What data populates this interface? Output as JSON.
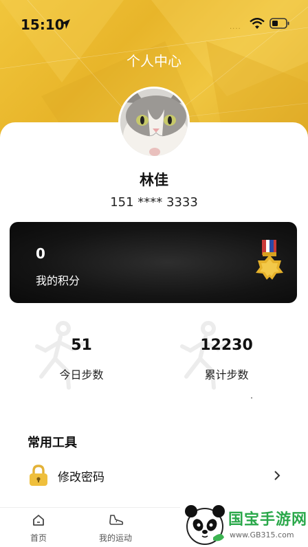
{
  "status_bar": {
    "time": "15:10",
    "signal_dots": "····"
  },
  "header": {
    "title": "个人中心"
  },
  "profile": {
    "name": "林佳",
    "phone": "151 **** 3333"
  },
  "points": {
    "value": "0",
    "label": "我的积分"
  },
  "steps": {
    "today": {
      "value": "51",
      "label": "今日步数"
    },
    "total": {
      "value": "12230",
      "label": "累计步数"
    }
  },
  "tools": {
    "title": "常用工具",
    "items": [
      {
        "label": "修改密码",
        "icon": "lock-icon"
      }
    ]
  },
  "tabbar": {
    "items": [
      {
        "label": "首页",
        "icon": "home-icon"
      },
      {
        "label": "我的运动",
        "icon": "sneaker-icon"
      }
    ]
  },
  "watermark": {
    "brand": "国宝手游网",
    "url": "www.GB315.com"
  },
  "colors": {
    "accent": "#f0c23a",
    "dark_card": "#141414",
    "watermark_green": "#2aa84a"
  }
}
